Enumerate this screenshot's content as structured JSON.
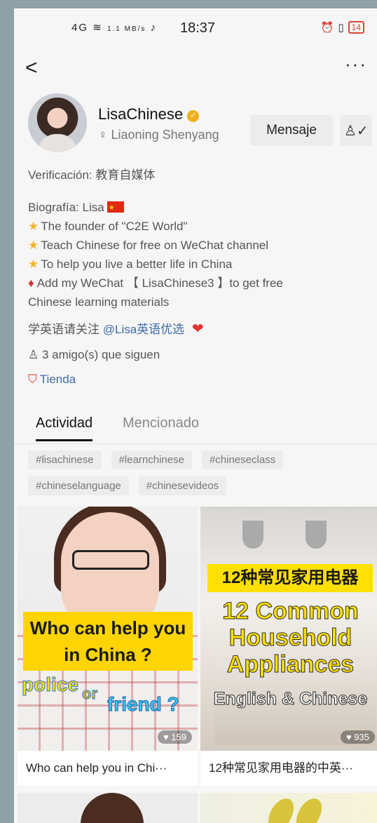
{
  "status_bar": {
    "network": "4G",
    "speed": "1.1 MB/s",
    "time": "18:37",
    "battery": "14"
  },
  "nav": {
    "back": "<",
    "more": "···"
  },
  "profile": {
    "name": "LisaChinese",
    "location": "Liaoning Shenyang",
    "message_button": "Mensaje",
    "verification": "Verificación: 教育自媒体",
    "bio_label": "Biografía: Lisa",
    "bio_lines": [
      "The founder of \"C2E World\"",
      "Teach Chinese for free on WeChat channel",
      "To help you live a better life in China",
      "Add my WeChat 【 LisaChinese3 】to get free",
      "Chinese learning materials"
    ],
    "promo_text": "学英语请关注",
    "promo_link": "@Lisa英语优选",
    "friends": "3 amigo(s) que siguen",
    "store": "Tienda"
  },
  "tabs": [
    "Actividad",
    "Mencionado"
  ],
  "tags": [
    "#lisachinese",
    "#learnchinese",
    "#chineseclass",
    "#chineselanguage",
    "#chinesevideos"
  ],
  "posts": [
    {
      "caption": "Who can help you in Chi···",
      "likes": "159",
      "overlay_main": [
        "Who can help you",
        "in China ?"
      ],
      "overlay_police": "police",
      "overlay_or": "or",
      "overlay_friend": "friend ?"
    },
    {
      "caption": "12种常见家用电器的中英···",
      "likes": "935",
      "overlay_cn": "12种常见家用电器",
      "overlay_en": [
        "12 Common",
        "Household",
        "Appliances"
      ],
      "overlay_sub": "English & Chinese"
    }
  ]
}
